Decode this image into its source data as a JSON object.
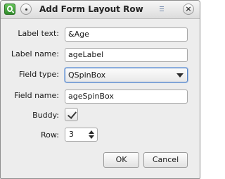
{
  "window": {
    "title": "Add Form Layout Row",
    "close_glyph": "×",
    "app_icon": "qt-designer-icon"
  },
  "form": {
    "label_text": {
      "label": "Label text:",
      "value": "&Age"
    },
    "label_name": {
      "label": "Label name:",
      "value": "ageLabel"
    },
    "field_type": {
      "label": "Field type:",
      "value": "QSpinBox"
    },
    "field_name": {
      "label": "Field name:",
      "value": "ageSpinBox"
    },
    "buddy": {
      "label": "Buddy:",
      "checked": true
    },
    "row": {
      "label": "Row:",
      "value": "3"
    }
  },
  "buttons": {
    "ok": "OK",
    "cancel": "Cancel"
  },
  "colors": {
    "focus_border": "#5b86c4",
    "window_bg": "#ededed"
  }
}
